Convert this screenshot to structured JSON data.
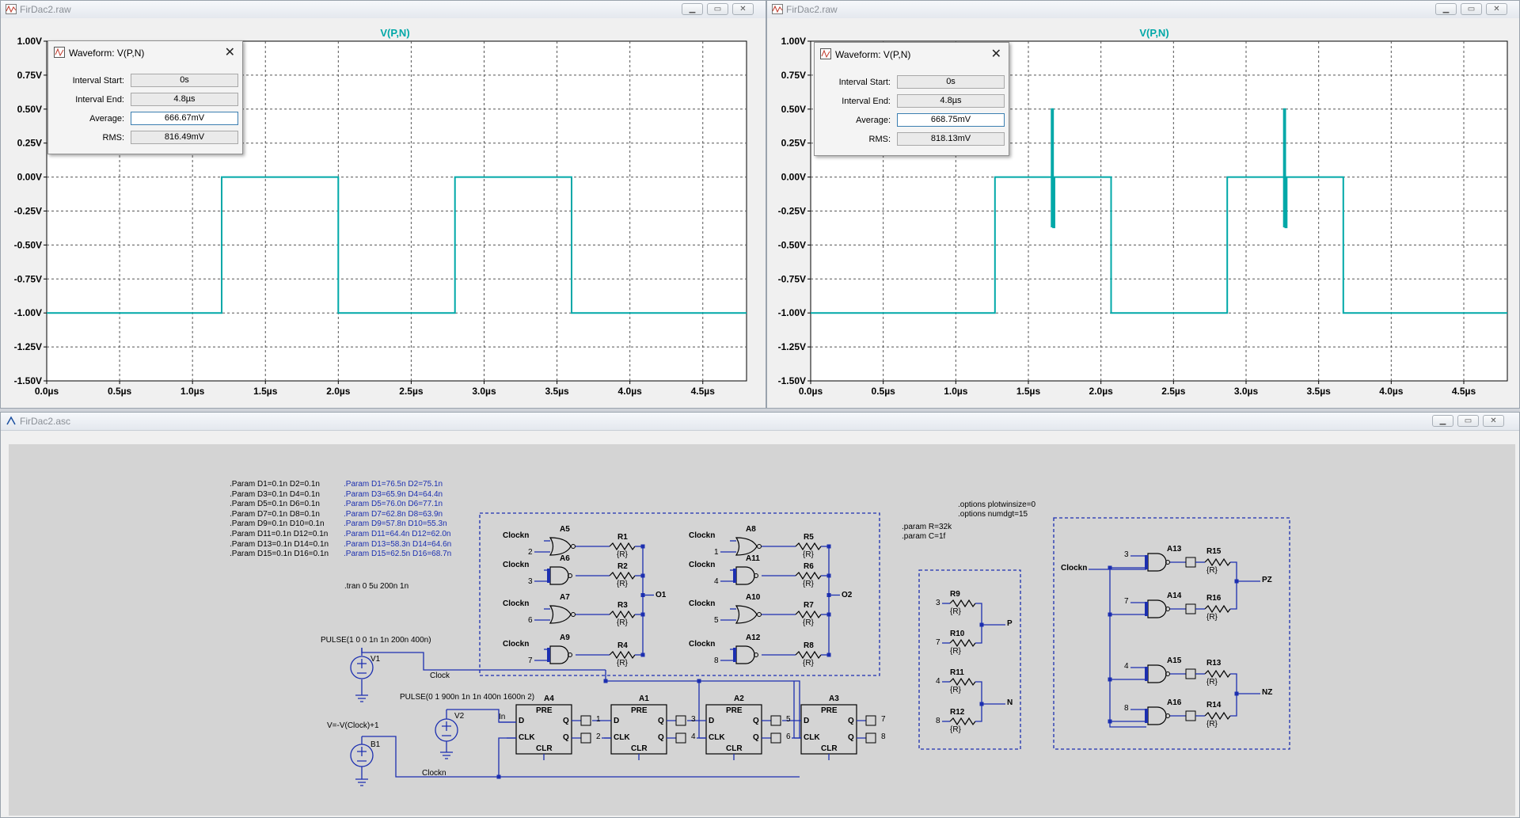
{
  "plot_left": {
    "window_title": "FirDac2.raw",
    "trace_label": "V(P,N)",
    "y_ticks": [
      "1.00V",
      "0.75V",
      "0.50V",
      "0.25V",
      "0.00V",
      "-0.25V",
      "-0.50V",
      "-0.75V",
      "-1.00V",
      "-1.25V",
      "-1.50V"
    ],
    "x_ticks": [
      "0.0µs",
      "0.5µs",
      "1.0µs",
      "1.5µs",
      "2.0µs",
      "2.5µs",
      "3.0µs",
      "3.5µs",
      "4.0µs",
      "4.5µs"
    ],
    "dialog": {
      "title": "Waveform: V(P,N)",
      "interval_start_label": "Interval Start:",
      "interval_start": "0s",
      "interval_end_label": "Interval End:",
      "interval_end": "4.8µs",
      "average_label": "Average:",
      "average": "666.67mV",
      "rms_label": "RMS:",
      "rms": "816.49mV"
    }
  },
  "plot_right": {
    "window_title": "FirDac2.raw",
    "trace_label": "V(P,N)",
    "y_ticks": [
      "1.00V",
      "0.75V",
      "0.50V",
      "0.25V",
      "0.00V",
      "-0.25V",
      "-0.50V",
      "-0.75V",
      "-1.00V",
      "-1.25V",
      "-1.50V"
    ],
    "x_ticks": [
      "0.0µs",
      "0.5µs",
      "1.0µs",
      "1.5µs",
      "2.0µs",
      "2.5µs",
      "3.0µs",
      "3.5µs",
      "4.0µs",
      "4.5µs"
    ],
    "dialog": {
      "title": "Waveform: V(P,N)",
      "interval_start_label": "Interval Start:",
      "interval_start": "0s",
      "interval_end_label": "Interval End:",
      "interval_end": "4.8µs",
      "average_label": "Average:",
      "average": "668.75mV",
      "rms_label": "RMS:",
      "rms": "818.13mV"
    }
  },
  "chart_data": [
    {
      "type": "line",
      "title": "V(P,N)",
      "xlim": [
        0,
        4.8
      ],
      "ylim": [
        -1.5,
        1.0
      ],
      "grid": true,
      "series": [
        {
          "name": "V(P,N)",
          "color": "#00a8a8",
          "x": [
            0,
            1.2,
            1.2,
            2.0,
            2.0,
            2.8,
            2.8,
            3.6,
            3.6,
            4.8
          ],
          "y": [
            -1,
            -1,
            0,
            0,
            -1,
            -1,
            0,
            0,
            -1,
            -1
          ]
        }
      ]
    },
    {
      "type": "line",
      "title": "V(P,N)",
      "xlim": [
        0,
        4.8
      ],
      "ylim": [
        -1.5,
        1.0
      ],
      "grid": true,
      "series": [
        {
          "name": "V(P,N)",
          "color": "#00a8a8",
          "x": [
            0,
            1.27,
            1.27,
            1.66,
            1.66,
            1.66,
            1.67,
            1.67,
            1.68,
            1.68,
            2.07,
            2.07,
            2.87,
            2.87,
            3.26,
            3.26,
            3.26,
            3.27,
            3.27,
            3.28,
            3.28,
            3.67,
            3.67,
            4.8
          ],
          "y": [
            -1,
            -1,
            0,
            0,
            -0.37,
            0.5,
            0.5,
            -0.37,
            -0.37,
            0,
            0,
            -1,
            -1,
            0,
            0,
            -0.37,
            0.5,
            0.5,
            -0.37,
            -0.37,
            0,
            0,
            -1,
            -1
          ]
        }
      ]
    }
  ],
  "schematic": {
    "window_title": "FirDac2.asc",
    "params_nominal": [
      ".Param D1=0.1n D2=0.1n",
      ".Param D3=0.1n D4=0.1n",
      ".Param D5=0.1n D6=0.1n",
      ".Param D7=0.1n D8=0.1n",
      ".Param D9=0.1n D10=0.1n",
      ".Param D11=0.1n D12=0.1n",
      ".Param D13=0.1n D14=0.1n",
      ".Param D15=0.1n D16=0.1n"
    ],
    "params_delay": [
      ".Param D1=76.5n D2=75.1n",
      ".Param D3=65.9n D4=64.4n",
      ".Param D5=76.0n D6=77.1n",
      ".Param D7=62.8n D8=63.9n",
      ".Param D9=57.8n D10=55.3n",
      ".Param D11=64.4n D12=62.0n",
      ".Param D13=58.3n D14=64.6n",
      ".Param D15=62.5n D16=68.7n"
    ],
    "tran": ".tran 0 5u 200n 1n",
    "options": [
      ".options plotwinsize=0",
      ".options numdgt=15"
    ],
    "params_rc": [
      ".param R=32k",
      ".param C=1f"
    ],
    "v1_value": "PULSE(1 0 0 1n 1n 200n 400n)",
    "v1_name": "V1",
    "v2_value": "PULSE(0 1 900n 1n 1n 400n 1600n 2)",
    "v2_name": "V2",
    "b1_value": "V=-V(Clock)+1",
    "b1_name": "B1",
    "net_clock": "Clock",
    "net_clockn": "Clockn",
    "net_in": "In",
    "flipflops": [
      {
        "name": "A4",
        "q": "1",
        "qn": "2"
      },
      {
        "name": "A1",
        "q": "3",
        "qn": "4"
      },
      {
        "name": "A2",
        "q": "5",
        "qn": "6"
      },
      {
        "name": "A3",
        "q": "7",
        "qn": "8"
      }
    ],
    "ff_pins": {
      "d": "D",
      "pre": "PRE",
      "clk": "CLK",
      "clr": "CLR",
      "q": "Q",
      "qn": "Q"
    },
    "group1": {
      "gates": [
        "A5",
        "A6",
        "A7",
        "A9"
      ],
      "inputs": [
        "2",
        "3",
        "6",
        "7"
      ],
      "resistors": [
        "R1",
        "R2",
        "R3",
        "R4"
      ],
      "out": "O1"
    },
    "group2": {
      "gates": [
        "A8",
        "A11",
        "A10",
        "A12"
      ],
      "inputs": [
        "1",
        "4",
        "5",
        "8"
      ],
      "resistors": [
        "R5",
        "R6",
        "R7",
        "R8"
      ],
      "out": "O2"
    },
    "group3": {
      "resistors": [
        "R9",
        "R10",
        "R11",
        "R12"
      ],
      "inputs": [
        "3",
        "7",
        "4",
        "8"
      ],
      "out_p": "P",
      "out_n": "N"
    },
    "group4": {
      "gates": [
        "A13",
        "A14",
        "A15",
        "A16"
      ],
      "inputs": [
        "3",
        "7",
        "4",
        "8"
      ],
      "resistors": [
        "R15",
        "R16",
        "R13",
        "R14"
      ],
      "out_pz": "PZ",
      "out_nz": "NZ"
    },
    "resistor_value": "{R}"
  }
}
